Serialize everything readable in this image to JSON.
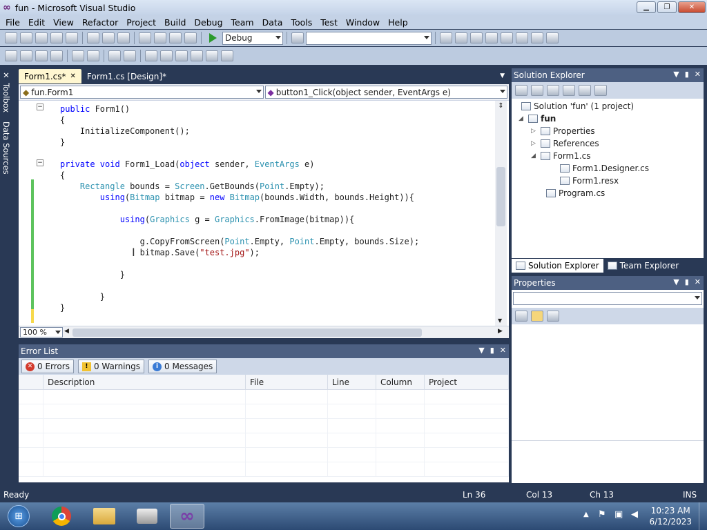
{
  "window": {
    "title": "fun - Microsoft Visual Studio",
    "controls": [
      "minimize",
      "restore",
      "close"
    ]
  },
  "menu": [
    "File",
    "Edit",
    "View",
    "Refactor",
    "Project",
    "Build",
    "Debug",
    "Team",
    "Data",
    "Tools",
    "Test",
    "Window",
    "Help"
  ],
  "toolbar": {
    "config": "Debug",
    "platform": ""
  },
  "left_rail": {
    "toolbox": "Toolbox",
    "data_sources": "Data Sources"
  },
  "editor": {
    "tabs": [
      {
        "label": "Form1.cs*",
        "active": true
      },
      {
        "label": "Form1.cs [Design]*",
        "active": false
      }
    ],
    "nav_class": "fun.Form1",
    "nav_member": "button1_Click(object sender, EventArgs e)",
    "zoom": "100 %",
    "lines": [
      [
        [
          "kw",
          "public "
        ],
        [
          "",
          "Form1()"
        ]
      ],
      [
        [
          "",
          "{"
        ]
      ],
      [
        [
          "",
          "    InitializeComponent();"
        ]
      ],
      [
        [
          "",
          "}"
        ]
      ],
      [
        [
          "",
          ""
        ]
      ],
      [
        [
          "kw",
          "private void "
        ],
        [
          "",
          "Form1_Load("
        ],
        [
          "kw",
          "object"
        ],
        [
          "",
          " sender, "
        ],
        [
          "ty",
          "EventArgs"
        ],
        [
          "",
          " e)"
        ]
      ],
      [
        [
          "",
          "{"
        ]
      ],
      [
        [
          "ty",
          "    Rectangle"
        ],
        [
          "",
          " bounds = "
        ],
        [
          "ty",
          "Screen"
        ],
        [
          "",
          ".GetBounds("
        ],
        [
          "ty",
          "Point"
        ],
        [
          "",
          ".Empty);"
        ]
      ],
      [
        [
          "kw",
          "        using"
        ],
        [
          "",
          "("
        ],
        [
          "ty",
          "Bitmap"
        ],
        [
          "",
          " bitmap = "
        ],
        [
          "kw",
          "new "
        ],
        [
          "ty",
          "Bitmap"
        ],
        [
          "",
          "(bounds.Width, bounds.Height)){"
        ]
      ],
      [
        [
          "",
          ""
        ]
      ],
      [
        [
          "kw",
          "            using"
        ],
        [
          "",
          "("
        ],
        [
          "ty",
          "Graphics"
        ],
        [
          "",
          " g = "
        ],
        [
          "ty",
          "Graphics"
        ],
        [
          "",
          ".FromImage(bitmap)){"
        ]
      ],
      [
        [
          "",
          ""
        ]
      ],
      [
        [
          "",
          "                g.CopyFromScreen("
        ],
        [
          "ty",
          "Point"
        ],
        [
          "",
          ".Empty, "
        ],
        [
          "ty",
          "Point"
        ],
        [
          "",
          ".Empty, bounds.Size);"
        ]
      ],
      [
        [
          "",
          "                bitmap.Save("
        ],
        [
          "st",
          "\"test.jpg\""
        ],
        [
          "",
          ");"
        ]
      ],
      [
        [
          "",
          ""
        ]
      ],
      [
        [
          "",
          "            }"
        ]
      ],
      [
        [
          "",
          ""
        ]
      ],
      [
        [
          "",
          "        }"
        ]
      ],
      [
        [
          "",
          "}"
        ]
      ]
    ]
  },
  "solution_explorer": {
    "title": "Solution Explorer",
    "solution": "Solution 'fun' (1 project)",
    "project": "fun",
    "items": {
      "properties": "Properties",
      "references": "References",
      "form1": "Form1.cs",
      "designer": "Form1.Designer.cs",
      "resx": "Form1.resx",
      "program": "Program.cs"
    },
    "tabs": [
      "Solution Explorer",
      "Team Explorer"
    ]
  },
  "properties": {
    "title": "Properties"
  },
  "error_list": {
    "title": "Error List",
    "errors": "0 Errors",
    "warnings": "0 Warnings",
    "messages": "0 Messages",
    "columns": [
      "Description",
      "File",
      "Line",
      "Column",
      "Project"
    ]
  },
  "status": {
    "text": "Ready",
    "ln": "Ln 36",
    "col": "Col 13",
    "ch": "Ch 13",
    "mode": "INS"
  },
  "taskbar": {
    "time": "10:23 AM",
    "date": "6/12/2023"
  }
}
